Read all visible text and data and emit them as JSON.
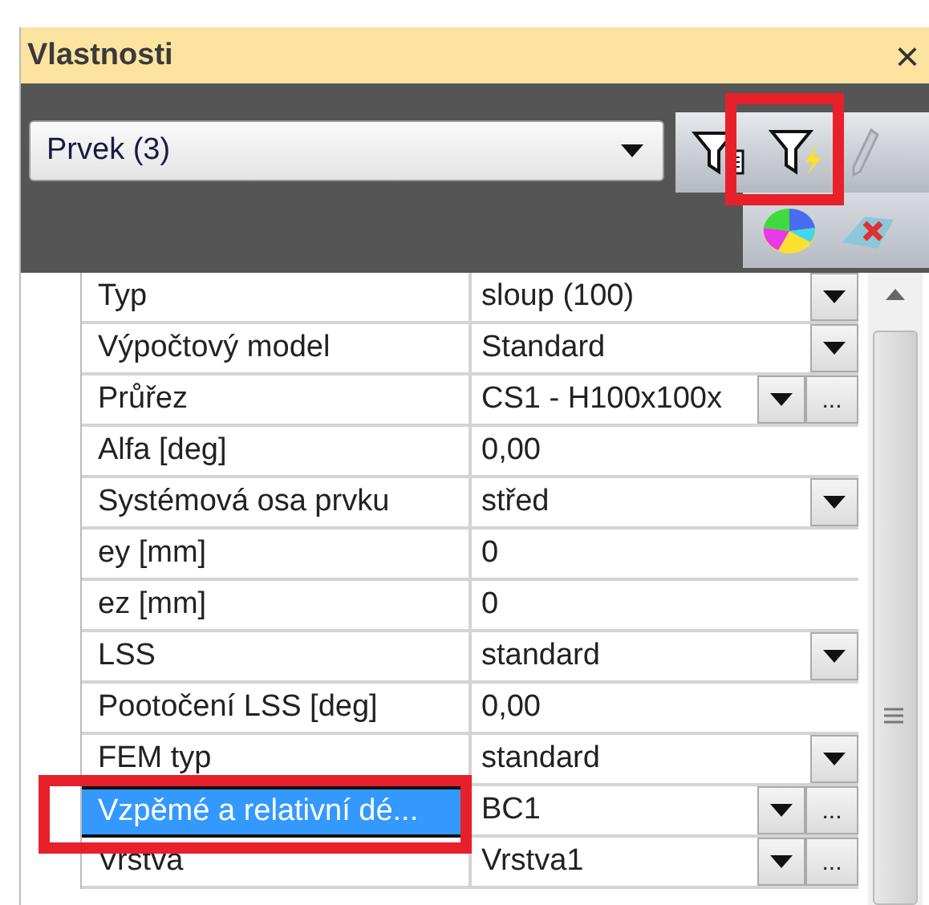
{
  "panel": {
    "title": "Vlastnosti",
    "close": "×"
  },
  "selector": {
    "value": "Prvek (3)"
  },
  "properties": [
    {
      "name": "Typ",
      "value": "sloup (100)",
      "kind": "dropdown",
      "selected": false
    },
    {
      "name": "Výpočtový model",
      "value": "Standard",
      "kind": "dropdown",
      "selected": false
    },
    {
      "name": "Průřez",
      "value": "CS1 - H100x100x",
      "kind": "dropdown_more",
      "more": "...",
      "selected": false
    },
    {
      "name": "Alfa [deg]",
      "value": "0,00",
      "kind": "text",
      "selected": false
    },
    {
      "name": "Systémová osa prvku",
      "value": "střed",
      "kind": "dropdown",
      "selected": false
    },
    {
      "name": "ey [mm]",
      "value": "0",
      "kind": "text",
      "selected": false
    },
    {
      "name": "ez [mm]",
      "value": "0",
      "kind": "text",
      "selected": false
    },
    {
      "name": "LSS",
      "value": "standard",
      "kind": "dropdown",
      "selected": false
    },
    {
      "name": "Pootočení LSS [deg]",
      "value": "0,00",
      "kind": "text",
      "selected": false
    },
    {
      "name": "FEM typ",
      "value": "standard",
      "kind": "dropdown",
      "selected": false
    },
    {
      "name": "Vzpěmé a relativní dé...",
      "value": "BC1",
      "kind": "dropdown_more",
      "more": "...",
      "selected": true
    },
    {
      "name": "Vrstva",
      "value": "Vrstva1",
      "kind": "dropdown_more",
      "more": "...",
      "selected": false
    }
  ]
}
